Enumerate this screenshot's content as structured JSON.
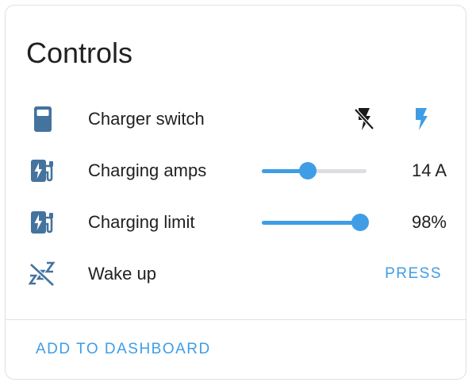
{
  "card": {
    "title": "Controls",
    "footer_action": "ADD TO DASHBOARD"
  },
  "colors": {
    "accent": "#3f9de6",
    "icon": "#44739e",
    "text": "#212121",
    "divider": "#e3e3e3"
  },
  "rows": [
    {
      "label": "Charger switch",
      "icon": "ev-charger-station-icon",
      "control": "toggle",
      "off_icon": "flash-off-icon",
      "on_icon": "flash-icon",
      "state": "on"
    },
    {
      "label": "Charging amps",
      "icon": "ev-station-icon",
      "control": "slider",
      "level": 0.44,
      "value": "14 A"
    },
    {
      "label": "Charging limit",
      "icon": "ev-station-icon",
      "control": "slider",
      "level": 0.94,
      "value": "98%"
    },
    {
      "label": "Wake up",
      "icon": "sleep-off-icon",
      "control": "button",
      "button_label": "PRESS"
    }
  ]
}
